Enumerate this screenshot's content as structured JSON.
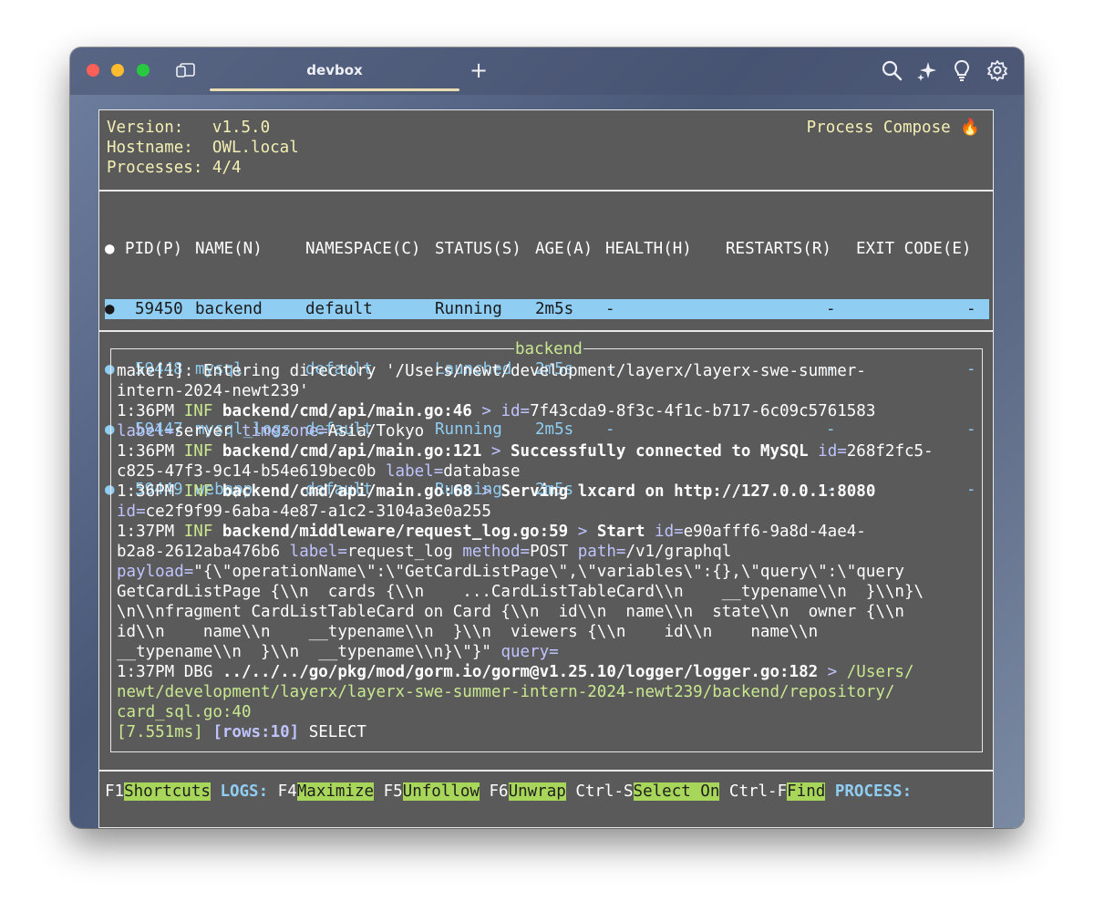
{
  "window": {
    "tab_title": "devbox"
  },
  "header": {
    "version_label": "Version:",
    "version": "v1.5.0",
    "hostname_label": "Hostname:",
    "hostname": "OWL.local",
    "processes_label": "Processes:",
    "processes": "4/4",
    "brand": "Process Compose 🔥"
  },
  "table": {
    "columns": [
      "PID(P)",
      "NAME(N)",
      "NAMESPACE(C)",
      "STATUS(S)",
      "AGE(A)",
      "HEALTH(H)",
      "RESTARTS(R)",
      "EXIT CODE(E)"
    ],
    "rows": [
      {
        "pid": "59450",
        "name": "backend",
        "namespace": "default",
        "status": "Running",
        "age": "2m5s",
        "health": "-",
        "restarts": "-",
        "exit": "-"
      },
      {
        "pid": "59448",
        "name": "mysql",
        "namespace": "default",
        "status": "Launched",
        "age": "2m5s",
        "health": "-",
        "restarts": "-",
        "exit": "-"
      },
      {
        "pid": "59447",
        "name": "mysql_logs",
        "namespace": "default",
        "status": "Running",
        "age": "2m5s",
        "health": "-",
        "restarts": "-",
        "exit": "-"
      },
      {
        "pid": "59449",
        "name": "webapp",
        "namespace": "default",
        "status": "Running",
        "age": "2m5s",
        "health": "-",
        "restarts": "-",
        "exit": "-"
      }
    ]
  },
  "log": {
    "title": "backend",
    "lines": {
      "l1": "make[1]: Entering directory '/Users/newt/development/layerx/layerx-swe-summer-",
      "l2": "intern-2024-newt239'",
      "l3_time": "1:36PM ",
      "l3_lvl": "INF",
      "l3_src": " backend/cmd/api/main.go:46",
      "l3_arrow": " > ",
      "l3_k1": "id=",
      "l3_v1": "7f43cda9-8f3c-4f1c-b717-6c09c5761583",
      "l4_k1": "label=",
      "l4_v1": "server ",
      "l4_k2": "timezone=",
      "l4_v2": "Asia/Tokyo",
      "l5_time": "1:36PM ",
      "l5_lvl": "INF",
      "l5_src": " backend/cmd/api/main.go:121",
      "l5_arrow": " > ",
      "l5_msg": "Successfully connected to MySQL ",
      "l5_k1": "id=",
      "l5_v1": "268f2fc5-",
      "l6_v1": "c825-47f3-9c14-b54e619bec0b ",
      "l6_k1": "label=",
      "l6_v2": "database",
      "l7_time": "1:36PM ",
      "l7_lvl": "INF",
      "l7_src": " backend/cmd/api/main.go:68",
      "l7_arrow": " > ",
      "l7_msg": "Serving lxcard on http://127.0.0.1:8080",
      "l8_k1": "id=",
      "l8_v1": "ce2f9f99-6aba-4e87-a1c2-3104a3e0a255",
      "l9_time": "1:37PM ",
      "l9_lvl": "INF",
      "l9_src": " backend/middleware/request_log.go:59",
      "l9_arrow": " > ",
      "l9_msg": "Start ",
      "l9_k1": "id=",
      "l9_v1": "e90afff6-9a8d-4ae4-",
      "l10_v1": "b2a8-2612aba476b6 ",
      "l10_k1": "label=",
      "l10_v2": "request_log ",
      "l10_k2": "method=",
      "l10_v3": "POST ",
      "l10_k3": "path=",
      "l10_v4": "/v1/graphql",
      "l11_k1": "payload=",
      "l11_v1": "\"{\\\"operationName\\\":\\\"GetCardListPage\\\",\\\"variables\\\":{},\\\"query\\\":\\\"query",
      "l12": "GetCardListPage {\\\\n  cards {\\\\n    ...CardListTableCard\\\\n    __typename\\\\n  }\\\\n}\\",
      "l13": "\\n\\\\nfragment CardListTableCard on Card {\\\\n  id\\\\n  name\\\\n  state\\\\n  owner {\\\\n",
      "l14": "id\\\\n    name\\\\n    __typename\\\\n  }\\\\n  viewers {\\\\n    id\\\\n    name\\\\n",
      "l15_v": "__typename\\\\n  }\\\\n  __typename\\\\n}\\\"}\" ",
      "l15_k": "query=",
      "l16_time": "1:37PM ",
      "l16_lvl": "DBG",
      "l16_src": " ../../../go/pkg/mod/gorm.io/gorm@v1.25.10/logger/logger.go:182",
      "l16_arrow": " > ",
      "l16_path": "/Users/",
      "l17": "newt/development/layerx/layerx-swe-summer-intern-2024-newt239/backend/repository/",
      "l18": "card_sql.go:40",
      "l19_a": "[7.551ms] ",
      "l19_b": "[rows:10]",
      "l19_c": " SELECT"
    }
  },
  "footer": {
    "f1_key": "F1",
    "f1_label": "Shortcuts",
    "logs_label": " LOGS: ",
    "f4_key": "F4",
    "f4_label": "Maximize",
    "f5_key": " F5",
    "f5_label": "Unfollow",
    "f6_key": " F6",
    "f6_label": "Unwrap",
    "ctrls_key": " Ctrl-S",
    "ctrls_label": "Select On",
    "ctrlf_key": " Ctrl-F",
    "ctrlf_label": "Find",
    "process_label": " PROCESS:"
  },
  "colors": {
    "accent_green": "#a8d65a",
    "accent_blue": "#8fcdf2",
    "info_yellow": "#f4efb4",
    "terminal_bg": "#5a5a5a"
  },
  "icons": [
    "sidebar-icon",
    "plus-icon",
    "search-icon",
    "sparkle-icon",
    "lightbulb-icon",
    "gear-icon",
    "fire-icon"
  ]
}
